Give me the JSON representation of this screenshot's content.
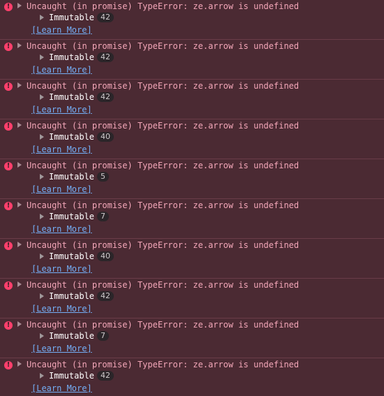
{
  "console": {
    "colors": {
      "background": "#4b2a33",
      "error_text": "#f3a6b8",
      "error_icon": "#ff3f6c",
      "link": "#74aef6"
    },
    "icons": {
      "error": "error-circle-icon",
      "expand": "triangle-right-icon"
    },
    "entries": [
      {
        "message": "Uncaught (in promise) TypeError: ze.arrow is undefined",
        "object_name": "Immutable",
        "count": "42",
        "link_text": "[Learn More]"
      },
      {
        "message": "Uncaught (in promise) TypeError: ze.arrow is undefined",
        "object_name": "Immutable",
        "count": "42",
        "link_text": "[Learn More]"
      },
      {
        "message": "Uncaught (in promise) TypeError: ze.arrow is undefined",
        "object_name": "Immutable",
        "count": "42",
        "link_text": "[Learn More]"
      },
      {
        "message": "Uncaught (in promise) TypeError: ze.arrow is undefined",
        "object_name": "Immutable",
        "count": "40",
        "link_text": "[Learn More]"
      },
      {
        "message": "Uncaught (in promise) TypeError: ze.arrow is undefined",
        "object_name": "Immutable",
        "count": "5",
        "link_text": "[Learn More]"
      },
      {
        "message": "Uncaught (in promise) TypeError: ze.arrow is undefined",
        "object_name": "Immutable",
        "count": "7",
        "link_text": "[Learn More]"
      },
      {
        "message": "Uncaught (in promise) TypeError: ze.arrow is undefined",
        "object_name": "Immutable",
        "count": "40",
        "link_text": "[Learn More]"
      },
      {
        "message": "Uncaught (in promise) TypeError: ze.arrow is undefined",
        "object_name": "Immutable",
        "count": "42",
        "link_text": "[Learn More]"
      },
      {
        "message": "Uncaught (in promise) TypeError: ze.arrow is undefined",
        "object_name": "Immutable",
        "count": "7",
        "link_text": "[Learn More]"
      },
      {
        "message": "Uncaught (in promise) TypeError: ze.arrow is undefined",
        "object_name": "Immutable",
        "count": "42",
        "link_text": "[Learn More]"
      }
    ]
  }
}
